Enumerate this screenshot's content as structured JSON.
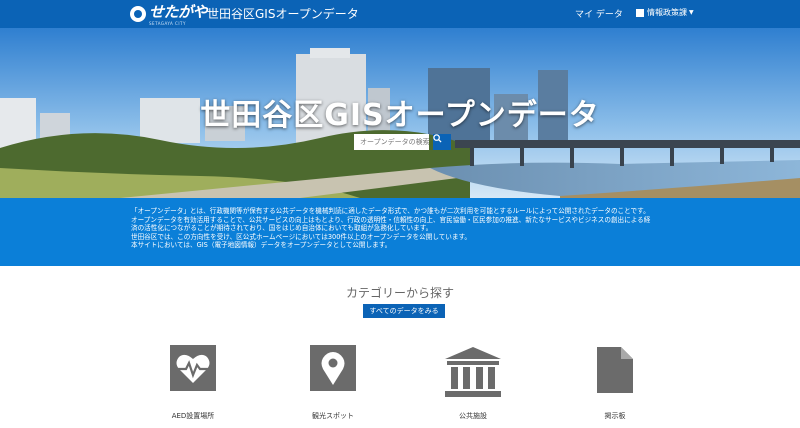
{
  "header": {
    "logo_text": "せたがや",
    "logo_sub": "SETAGAYA CITY",
    "site_title": "世田谷区GISオープンデータ",
    "nav": {
      "my_data": "マイ データ",
      "menu": "情報政策課"
    }
  },
  "hero": {
    "title": "世田谷区GISオープンデータ",
    "search_placeholder": "オープンデータの検索"
  },
  "intro": {
    "lines": [
      "「オープンデータ」とは、行政機関等が保有する公共データを機械判読に適したデータ形式で、かつ誰もが二次利用を可能とするルールによって公開されたデータのことです。",
      "オープンデータを有効活用することで、公共サービスの向上はもとより、行政の透明性・信頼性の向上、官民協働・区民参加の推進、新たなサービスやビジネスの創出による経",
      "済の活性化につながることが期待されており、国をはじめ自治体においても取組が急務化しています。",
      "世田谷区では、この方向性を受け、区公式ホームページにおいては300件以上のオープンデータを公開しています。",
      "本サイトにおいては、GIS（電子地図情報）データをオープンデータとして公開します。"
    ]
  },
  "categories": {
    "heading": "カテゴリーから探す",
    "all_button": "すべてのデータをみる",
    "items": [
      {
        "label": "AED設置場所",
        "icon": "heart-pulse-icon"
      },
      {
        "label": "観光スポット",
        "icon": "map-pin-icon"
      },
      {
        "label": "公共施設",
        "icon": "building-columns-icon"
      },
      {
        "label": "掲示板",
        "icon": "document-icon"
      }
    ]
  },
  "colors": {
    "header": "#0b63b6",
    "intro_band": "#0b7fd8",
    "icon_gray": "#6b6b6b"
  }
}
